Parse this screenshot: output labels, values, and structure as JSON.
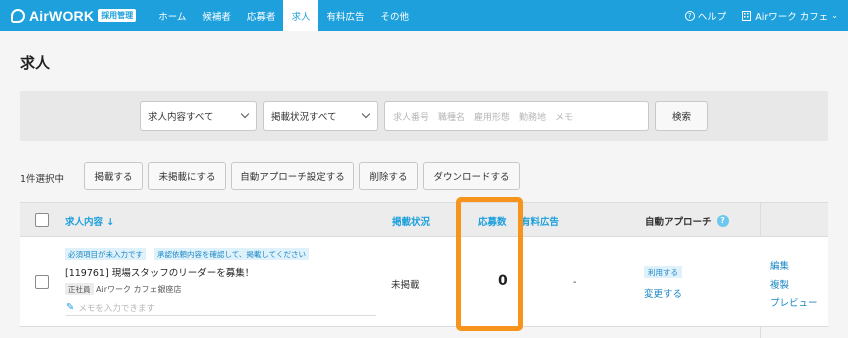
{
  "brand": {
    "name": "AirWORK",
    "badge": "採用管理"
  },
  "nav": {
    "items": [
      {
        "label": "ホーム"
      },
      {
        "label": "候補者"
      },
      {
        "label": "応募者"
      },
      {
        "label": "求人",
        "active": true
      },
      {
        "label": "有料広告"
      },
      {
        "label": "その他"
      }
    ],
    "help": "ヘルプ",
    "account": "Airワーク カフェ"
  },
  "page": {
    "title": "求人"
  },
  "search": {
    "content_filter": "求人内容すべて",
    "status_filter": "掲載状況すべて",
    "placeholder": "求人番号　職種名　雇用形態　勤務地　メモ",
    "button": "検索"
  },
  "actions": {
    "selected_count": "1件選択中",
    "publish": "掲載する",
    "unpublish": "未掲載にする",
    "auto_approach": "自動アプローチ設定する",
    "delete": "削除する",
    "download": "ダウンロードする"
  },
  "table": {
    "headers": {
      "content": "求人内容 ↓",
      "status": "掲載状況",
      "applications": "応募数",
      "paid_ad": "有料広告",
      "auto_approach": "自動アプローチ",
      "auto_approach_help": "?"
    },
    "rows": [
      {
        "tags": [
          "必須項目が未入力です",
          "承認依頼内容を確認して、掲載してください"
        ],
        "title": "[119761] 現場スタッフのリーダーを募集！",
        "employment": "正社員",
        "store": "Airワーク カフェ銀座店",
        "memo_placeholder": "メモを入力できます",
        "status": "未掲載",
        "applications": "0",
        "paid_ad": "-",
        "auto_approach_pill": "利用する",
        "auto_approach_change": "変更する",
        "links": {
          "edit": "編集",
          "copy": "複製",
          "preview": "プレビュー"
        }
      }
    ]
  },
  "colors": {
    "brand": "#1ea0dc",
    "highlight": "#f7941d"
  }
}
